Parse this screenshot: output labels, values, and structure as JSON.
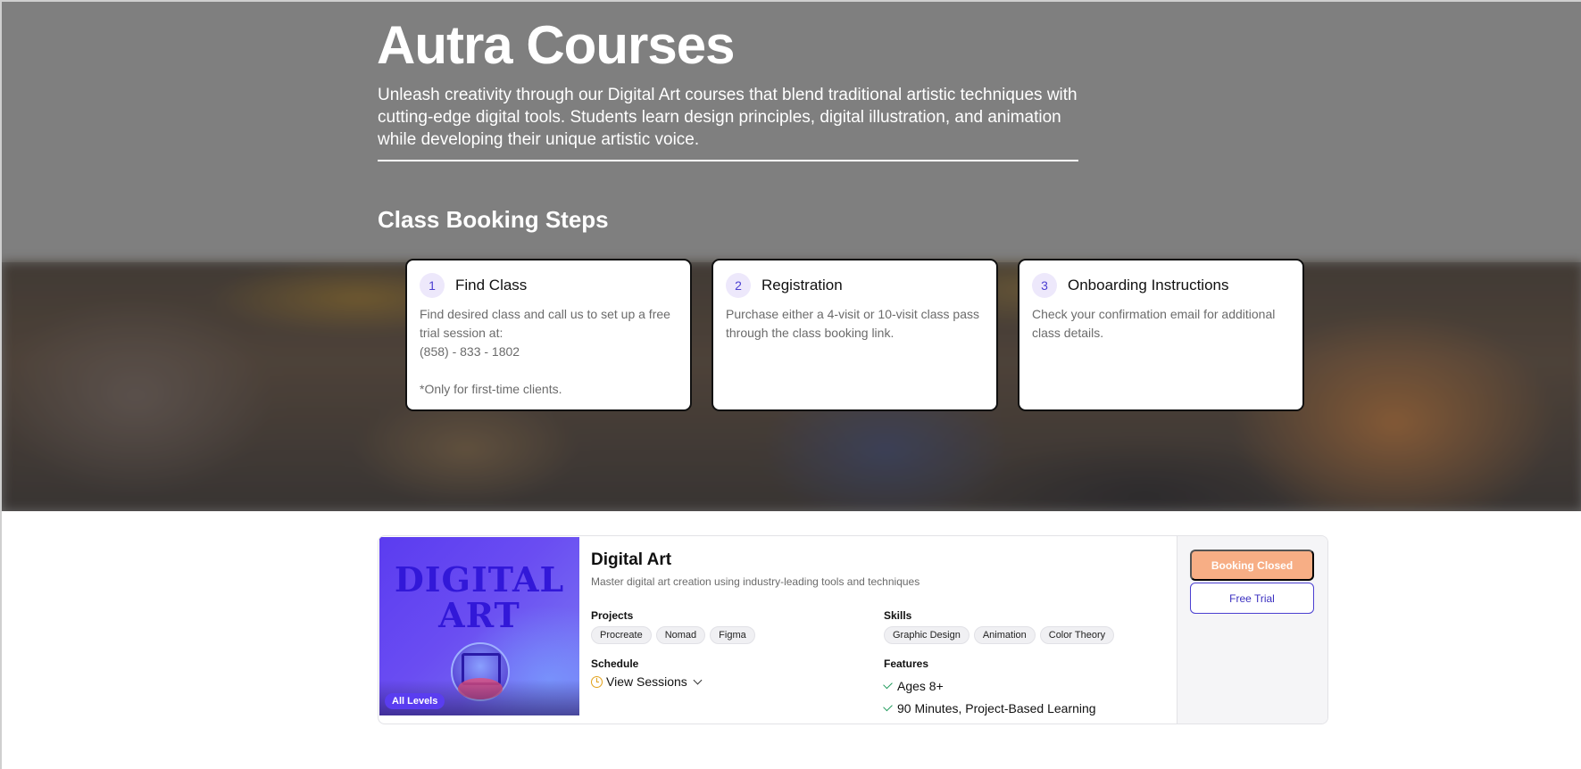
{
  "hero": {
    "title": "Autra Courses",
    "description": "Unleash creativity through our Digital Art courses that blend traditional artistic techniques with cutting-edge digital tools. Students learn design principles, digital illustration, and animation while developing their unique artistic voice."
  },
  "steps": {
    "heading": "Class Booking Steps",
    "items": [
      {
        "number": "1",
        "title": "Find Class",
        "body": [
          "Find desired class and call us to set up a free trial session at:",
          "(858) - 833 - 1802",
          "",
          "*Only for first-time clients."
        ]
      },
      {
        "number": "2",
        "title": "Registration",
        "body": [
          "Purchase either a 4-visit or 10-visit class pass through the class booking link."
        ]
      },
      {
        "number": "3",
        "title": "Onboarding Instructions",
        "body": [
          "Check your confirmation email for additional class details."
        ]
      }
    ]
  },
  "course": {
    "thumbnail_title_line1": "DIGITAL",
    "thumbnail_title_line2": "ART",
    "level_badge": "All Levels",
    "name": "Digital Art",
    "subtitle": "Master digital art creation using industry-leading tools and techniques",
    "projects_label": "Projects",
    "projects": [
      "Procreate",
      "Nomad",
      "Figma"
    ],
    "skills_label": "Skills",
    "skills": [
      "Graphic Design",
      "Animation",
      "Color Theory"
    ],
    "schedule_label": "Schedule",
    "schedule_link": "View Sessions",
    "features_label": "Features",
    "features": [
      "Ages 8+",
      "90 Minutes, Project-Based Learning"
    ],
    "booking_button": "Booking Closed",
    "trial_button": "Free Trial"
  },
  "icons": {
    "schedule": "clock-icon",
    "dropdown": "chevron-down-icon",
    "feature": "check-icon"
  },
  "colors": {
    "accent": "#4b3fd1",
    "booking_closed": "#f7ae85",
    "check": "#1e9a5a",
    "clock": "#e2a11a"
  }
}
